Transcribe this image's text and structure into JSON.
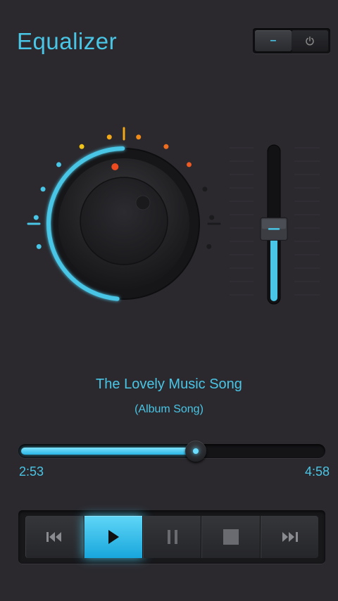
{
  "app": {
    "title": "Equalizer"
  },
  "power_toggle": {
    "left_segment": "–",
    "right_segment_icon": "power-icon",
    "state": "on"
  },
  "knob": {
    "level": 0.62,
    "accent": "#49c6e6",
    "dot_colors": [
      "#49c6e6",
      "#49c6e6",
      "#49c6e6",
      "#49c6e6",
      "#f2c418",
      "#f2a818",
      "#f08a18",
      "#f06d20",
      "#ee5a23",
      "#1b1b1e",
      "#1b1b1e",
      "#1b1b1e"
    ],
    "indicator_color": "#ee4a20"
  },
  "volume_slider": {
    "level": 0.47,
    "accent": "#49c6e6"
  },
  "song": {
    "title": "The Lovely Music Song",
    "album": "(Album Song)"
  },
  "progress": {
    "elapsed": "2:53",
    "total": "4:58",
    "fraction": 0.58
  },
  "transport": {
    "buttons": [
      {
        "icon": "rewind-icon",
        "active": false
      },
      {
        "icon": "play-icon",
        "active": true
      },
      {
        "icon": "pause-icon",
        "active": false
      },
      {
        "icon": "stop-icon",
        "active": false
      },
      {
        "icon": "fast-forward-icon",
        "active": false
      }
    ]
  },
  "colors": {
    "accent": "#49c6e6",
    "background": "#2b292e"
  }
}
